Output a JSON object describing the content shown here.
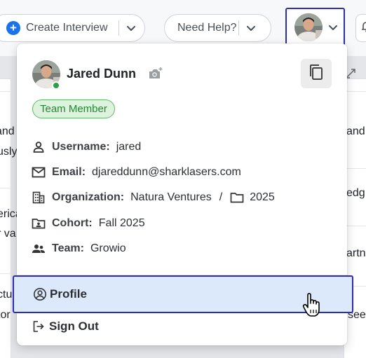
{
  "toolbar": {
    "create_label": "Create Interview",
    "help_label": "Need Help?"
  },
  "background_fragments": {
    "left": [
      "and",
      "usly",
      "erica",
      "r va",
      "ctu",
      "tor"
    ],
    "right": [
      "and",
      "edg",
      "artn",
      "see"
    ]
  },
  "profile_menu": {
    "name": "Jared Dunn",
    "role_badge": "Team Member",
    "fields": {
      "username_label": "Username:",
      "username_value": "jared",
      "email_label": "Email:",
      "email_value": "djareddunn@sharklasers.com",
      "organization_label": "Organization:",
      "organization_value": "Natura Ventures",
      "organization_separator": "/",
      "organization_folder": "2025",
      "cohort_label": "Cohort:",
      "cohort_value": "Fall 2025",
      "team_label": "Team:",
      "team_value": "Growio"
    },
    "items": {
      "profile_label": "Profile",
      "signout_label": "Sign Out"
    }
  },
  "colors": {
    "accent": "#2b2db8",
    "primary_blue": "#1a73e8",
    "badge_green": "#1e8a2e",
    "online_green": "#2e9e4a",
    "highlight": "#dce9fb"
  },
  "icons": {
    "plus": "plus-circle-icon",
    "chevron": "chevron-down-icon",
    "camera": "camera-add-icon",
    "copy": "copy-icon",
    "user": "user-icon",
    "mail": "mail-icon",
    "building": "building-icon",
    "folder": "folder-icon",
    "contact_card": "contact-card-icon",
    "team": "team-icon",
    "profile": "account-circle-icon",
    "logout": "logout-icon",
    "cursor": "hand-cursor-icon"
  }
}
